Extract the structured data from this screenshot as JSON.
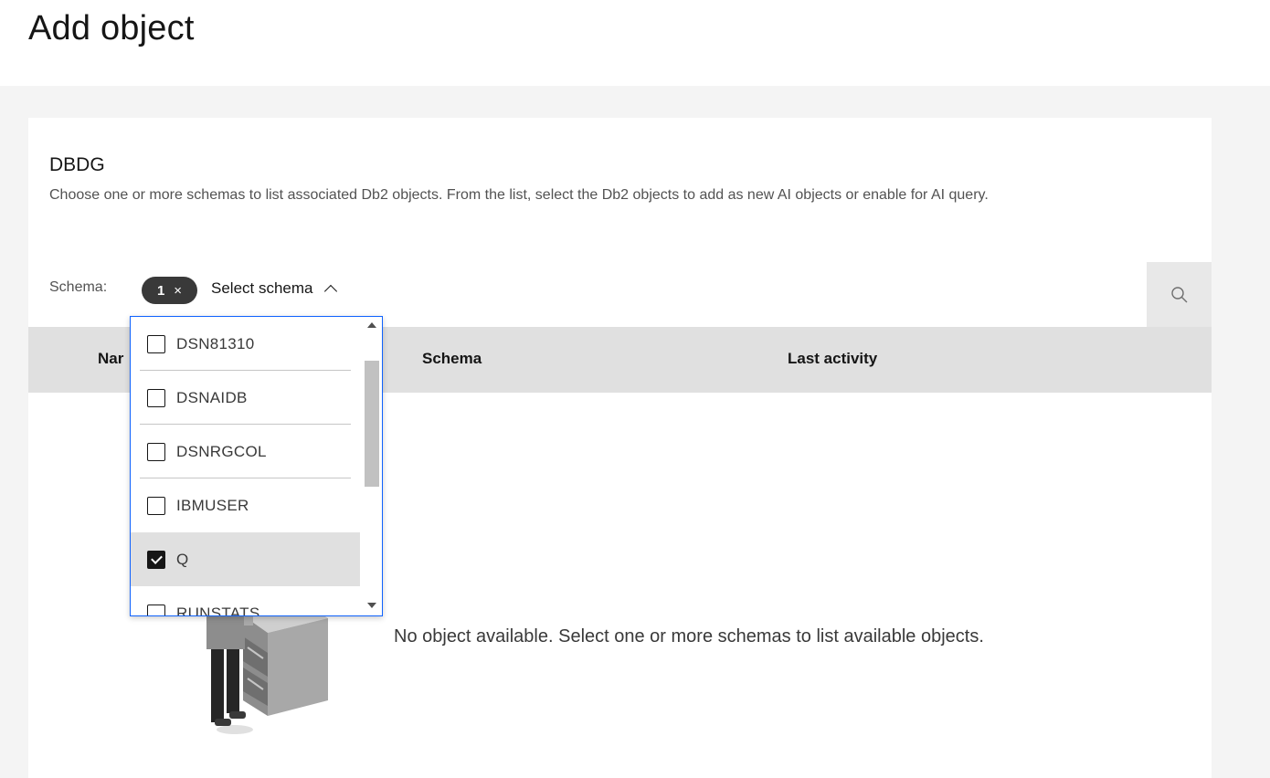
{
  "page": {
    "title": "Add object"
  },
  "card": {
    "title": "DBDG",
    "description": "Choose one or more schemas to list associated Db2 objects. From the list, select the Db2 objects to add as new AI objects or enable for AI query."
  },
  "filter": {
    "label": "Schema:",
    "tag_count": "1",
    "tag_clear": "×",
    "select_placeholder": "Select schema",
    "search_icon": "search-icon"
  },
  "table": {
    "columns": [
      "Nar",
      "Schema",
      "Last activity"
    ],
    "empty_message": "No object available. Select one or more schemas to list available objects."
  },
  "dropdown": {
    "options": [
      {
        "label": "DSN81310",
        "checked": false
      },
      {
        "label": "DSNAIDB",
        "checked": false
      },
      {
        "label": "DSNRGCOL",
        "checked": false
      },
      {
        "label": "IBMUSER",
        "checked": false
      },
      {
        "label": "Q",
        "checked": true
      },
      {
        "label": "RUNSTATS",
        "checked": false
      }
    ]
  },
  "colors": {
    "focus": "#0f62fe",
    "tag": "#393939",
    "header": "#e0e0e0"
  }
}
